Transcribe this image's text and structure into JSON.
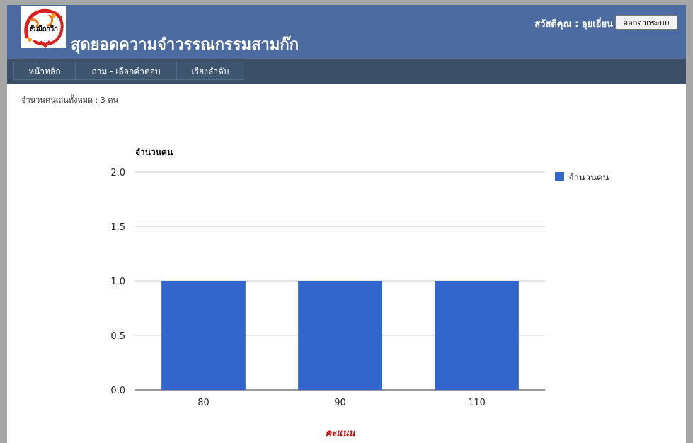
{
  "header": {
    "logo_text": "สัมมีถกวีก",
    "title": "สุดยอดความจำวรรณกรรมสามก๊ก",
    "greeting": "สวัสดีคุณ : อุยเอี๋ยน",
    "logout_label": "ออกจากระบบ"
  },
  "nav": {
    "items": [
      {
        "label": "หน้าหลัก"
      },
      {
        "label": "ถาม - เลือกคำตอบ"
      },
      {
        "label": "เรียงลำดับ"
      }
    ]
  },
  "main": {
    "player_count_text": "จำนวนคนเล่นทั้งหมด : 3 คน"
  },
  "colors": {
    "header": "#4c6ba0",
    "navbar": "#3b5068",
    "bar": "#3366cc",
    "xlabel": "#cc0000"
  },
  "chart_data": {
    "type": "bar",
    "categories": [
      "80",
      "90",
      "110"
    ],
    "series": [
      {
        "name": "จำนวนคน",
        "values": [
          1,
          1,
          1
        ]
      }
    ],
    "ylabel": "จำนวนคน",
    "xlabel": "คะแนน",
    "ylim": [
      0,
      2
    ],
    "yticks": [
      "0.0",
      "0.5",
      "1.0",
      "1.5",
      "2.0"
    ],
    "grid": true,
    "legend": "right"
  }
}
